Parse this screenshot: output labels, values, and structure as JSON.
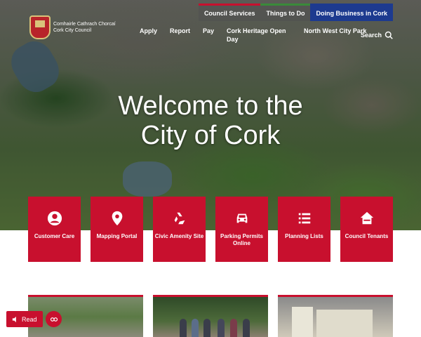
{
  "logo": {
    "line1": "Comhairle Cathrach Chorcaí",
    "line2": "Cork City Council"
  },
  "topnav": [
    {
      "label": "Council Services"
    },
    {
      "label": "Things to Do"
    },
    {
      "label": "Doing Business in Cork"
    }
  ],
  "mainnav": [
    {
      "label": "Apply"
    },
    {
      "label": "Report"
    },
    {
      "label": "Pay"
    },
    {
      "label": "Cork Heritage Open Day"
    },
    {
      "label": "North West City Park"
    }
  ],
  "search": {
    "label": "Search"
  },
  "hero": {
    "title_line1": "Welcome to the",
    "title_line2": "City of Cork"
  },
  "tiles": [
    {
      "label": "Customer Care",
      "icon": "person-icon"
    },
    {
      "label": "Mapping Portal",
      "icon": "map-pin-icon"
    },
    {
      "label": "Civic Amenity Site",
      "icon": "recycle-icon"
    },
    {
      "label": "Parking Permits Online",
      "icon": "car-icon"
    },
    {
      "label": "Planning Lists",
      "icon": "list-icon"
    },
    {
      "label": "Council Tenants",
      "icon": "house-icon"
    }
  ],
  "floating": {
    "read_label": "Read"
  },
  "colors": {
    "accent": "#c8102e",
    "business": "#1d3a8f"
  }
}
